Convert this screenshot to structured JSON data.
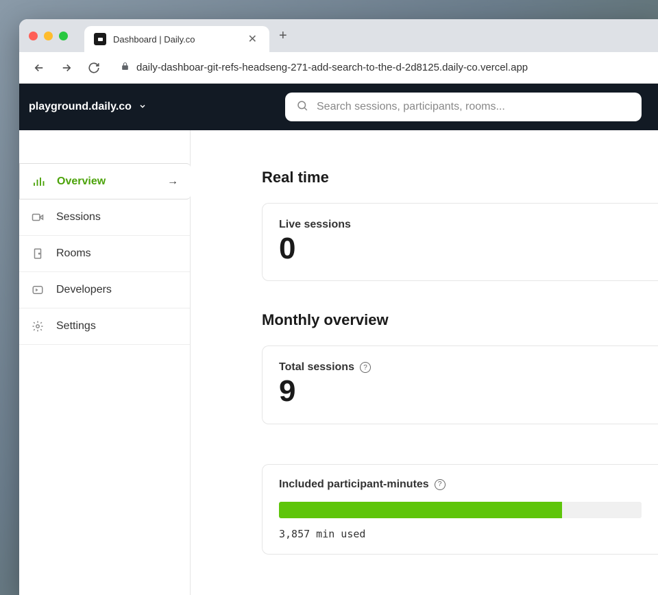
{
  "browser": {
    "tab_title": "Dashboard | Daily.co",
    "url": "daily-dashboar-git-refs-headseng-271-add-search-to-the-d-2d8125.daily-co.vercel.app"
  },
  "header": {
    "domain": "playground.daily.co",
    "search_placeholder": "Search sessions, participants, rooms..."
  },
  "sidebar": {
    "items": [
      {
        "label": "Overview",
        "active": true
      },
      {
        "label": "Sessions"
      },
      {
        "label": "Rooms"
      },
      {
        "label": "Developers"
      },
      {
        "label": "Settings"
      }
    ]
  },
  "main": {
    "realtime_heading": "Real time",
    "live_sessions": {
      "label": "Live sessions",
      "value": "0"
    },
    "monthly_heading": "Monthly overview",
    "total_sessions": {
      "label": "Total sessions",
      "value": "9"
    },
    "participant_minutes": {
      "label": "Included participant-minutes",
      "used_text": "3,857 min used",
      "percent": 78
    }
  }
}
